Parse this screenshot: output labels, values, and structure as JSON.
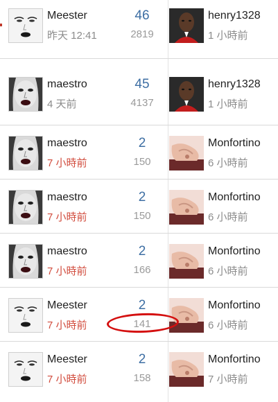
{
  "rows": [
    {
      "author": "Meester",
      "author_time": "昨天 12:41",
      "author_time_color": "grey",
      "replies": "46",
      "views": "2819",
      "last_poster": "henry1328",
      "last_time": "1 小時前",
      "author_avatar": "face-avatar-light",
      "last_avatar": "henry-avatar"
    },
    {
      "author": "maestro",
      "author_time": "4 天前",
      "author_time_color": "grey",
      "replies": "45",
      "views": "4137",
      "last_poster": "henry1328",
      "last_time": "1 小時前",
      "author_avatar": "face-avatar-dark",
      "last_avatar": "henry-avatar"
    },
    {
      "author": "maestro",
      "author_time": "7 小時前",
      "author_time_color": "red",
      "replies": "2",
      "views": "150",
      "last_poster": "Monfortino",
      "last_time": "6 小時前",
      "author_avatar": "face-avatar-dark",
      "last_avatar": "monfortino-avatar"
    },
    {
      "author": "maestro",
      "author_time": "7 小時前",
      "author_time_color": "red",
      "replies": "2",
      "views": "150",
      "last_poster": "Monfortino",
      "last_time": "6 小時前",
      "author_avatar": "face-avatar-dark",
      "last_avatar": "monfortino-avatar"
    },
    {
      "author": "maestro",
      "author_time": "7 小時前",
      "author_time_color": "red",
      "replies": "2",
      "views": "166",
      "last_poster": "Monfortino",
      "last_time": "6 小時前",
      "author_avatar": "face-avatar-dark",
      "last_avatar": "monfortino-avatar"
    },
    {
      "author": "Meester",
      "author_time": "7 小時前",
      "author_time_color": "red",
      "replies": "2",
      "views": "141",
      "last_poster": "Monfortino",
      "last_time": "6 小時前",
      "author_avatar": "face-avatar-light",
      "last_avatar": "monfortino-avatar"
    },
    {
      "author": "Meester",
      "author_time": "7 小時前",
      "author_time_color": "red",
      "replies": "2",
      "views": "158",
      "last_poster": "Monfortino",
      "last_time": "7 小時前",
      "author_avatar": "face-avatar-light",
      "last_avatar": "monfortino-avatar"
    }
  ],
  "colors": {
    "replies": "#3d6ea3",
    "time_red": "#d14b3c",
    "time_grey": "#8b8b8b",
    "annotation": "#d40f0f"
  }
}
